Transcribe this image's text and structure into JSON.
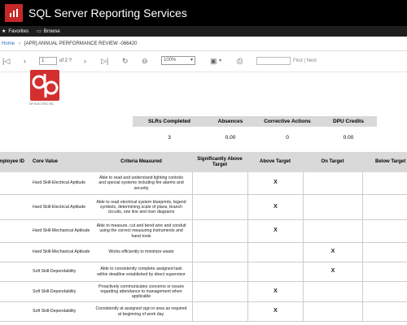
{
  "app": {
    "title": "SQL Server Reporting Services"
  },
  "favbar": {
    "favorites": "Favorites",
    "browse": "Browse"
  },
  "breadcrumb": {
    "home": "Home",
    "separator": "›",
    "report": "[APR] ANNUAL PERFORMANCE REVIEW -066420"
  },
  "toolbar": {
    "first": "|◁",
    "prev": "‹",
    "page_value": "1",
    "page_total": "of 2 ?",
    "next": "›",
    "last": "▷|",
    "refresh": "↻",
    "back": "⊖",
    "zoom": "100%",
    "zoom_caret": "▾",
    "save": "▣",
    "save_caret": "▾",
    "print": "⎙",
    "find_label": "Find | Next"
  },
  "logo": {
    "caption": "DP ELECTRIC INC."
  },
  "stats": {
    "headers": [
      "SLRs Completed",
      "Absences",
      "Corrective Actions",
      "DPU Credits"
    ],
    "values": [
      "3",
      "0.00",
      "0",
      "0.00"
    ]
  },
  "grid": {
    "headers": {
      "employee_id": "Employee ID",
      "core_value": "Core Value",
      "criteria": "Criteria Measured",
      "significantly_above": "Significantly Above Target",
      "above": "Above Target",
      "on": "On Target",
      "below": "Below Target"
    },
    "rows": [
      {
        "core": "Hard Skill-Electrical Aptitude",
        "criteria": "Able to read and understand lighting controls and special systems including fire alarms and security",
        "sig": "",
        "above": "X",
        "on": "",
        "below": ""
      },
      {
        "core": "Hard Skill-Electrical Aptitude",
        "criteria": "Able to read electrical system blueprints, legend symbols, determining scale of plans, branch circuits, one line and riser diagrams",
        "sig": "",
        "above": "X",
        "on": "",
        "below": ""
      },
      {
        "core": "Hard Skill-Mechanical Aptitude",
        "criteria": "Able to measure, cut and bend wire and conduit using the correct measuring instruments and hand tools",
        "sig": "",
        "above": "X",
        "on": "",
        "below": ""
      },
      {
        "core": "Hard Skill-Mechanical Aptitude",
        "criteria": "Works efficiently to minimize waste",
        "sig": "",
        "above": "",
        "on": "X",
        "below": ""
      },
      {
        "core": "Soft Skill-Dependability",
        "criteria": "Able to consistently complete assigned task within deadline established by direct supervisor",
        "sig": "",
        "above": "",
        "on": "X",
        "below": ""
      },
      {
        "core": "Soft Skill-Dependability",
        "criteria": "Proactively communicates concerns or issues regarding attendance to management when applicable",
        "sig": "",
        "above": "X",
        "on": "",
        "below": ""
      },
      {
        "core": "Soft Skill-Dependability",
        "criteria": "Consistently at assigned sign in area as required at beginning of work day.",
        "sig": "",
        "above": "X",
        "on": "",
        "below": ""
      }
    ]
  }
}
